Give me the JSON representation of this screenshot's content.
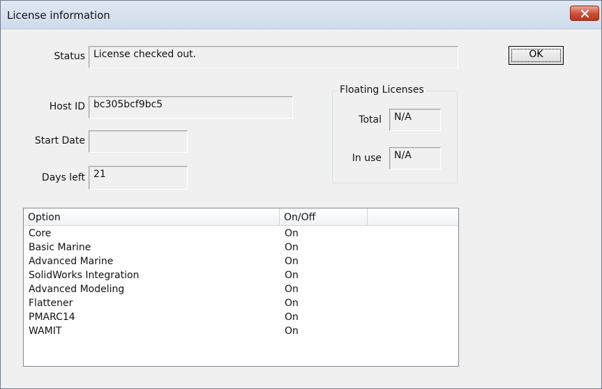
{
  "window": {
    "title": "License information",
    "close_label": "×"
  },
  "status": {
    "label": "Status",
    "value": "License checked out."
  },
  "host_id": {
    "label": "Host ID",
    "value": "bc305bcf9bc5"
  },
  "start_date": {
    "label": "Start Date",
    "value": ""
  },
  "days_left": {
    "label": "Days left",
    "value": "21"
  },
  "ok_button": {
    "label": "OK"
  },
  "floating": {
    "title": "Floating Licenses",
    "total_label": "Total",
    "total_value": "N/A",
    "in_use_label": "In use",
    "in_use_value": "N/A"
  },
  "options_table": {
    "columns": [
      "Option",
      "On/Off",
      ""
    ],
    "rows": [
      [
        "Core",
        "On"
      ],
      [
        "Basic Marine",
        "On"
      ],
      [
        "Advanced Marine",
        "On"
      ],
      [
        "SolidWorks Integration",
        "On"
      ],
      [
        "Advanced Modeling",
        "On"
      ],
      [
        "Flattener",
        "On"
      ],
      [
        "PMARC14",
        "On"
      ],
      [
        "WAMIT",
        "On"
      ]
    ]
  }
}
